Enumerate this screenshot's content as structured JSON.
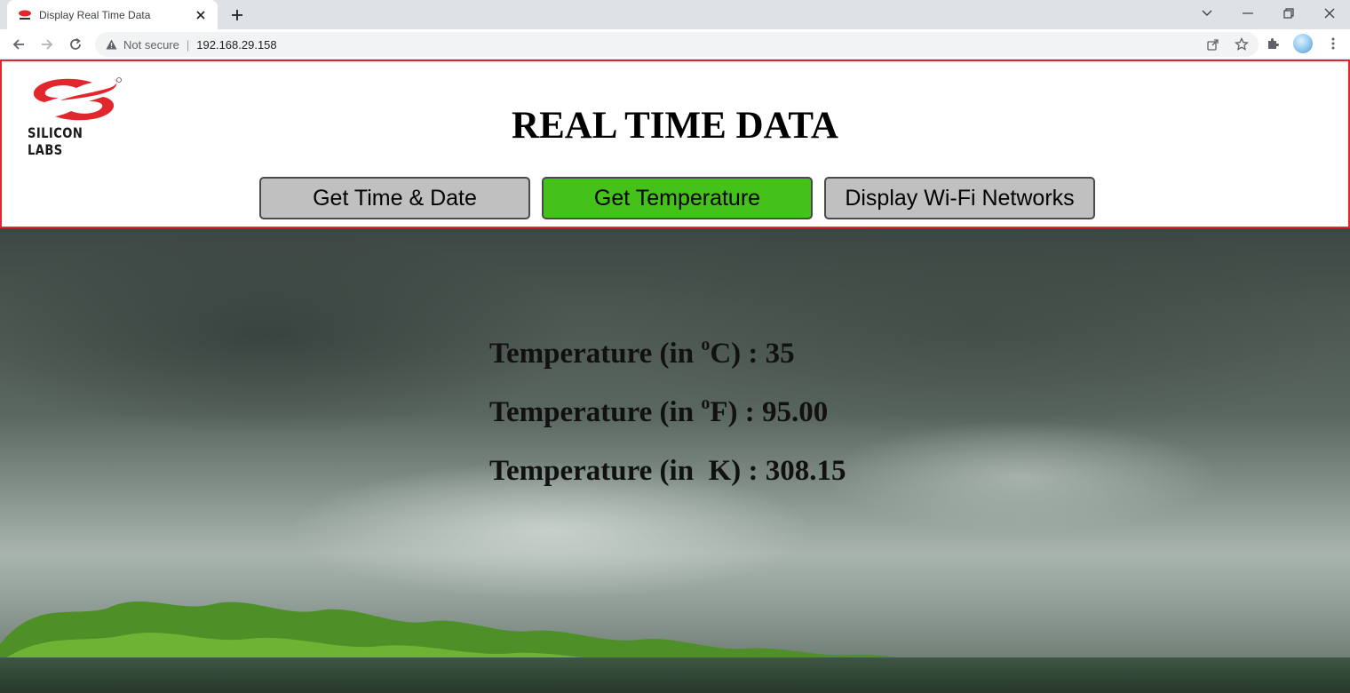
{
  "browser": {
    "tab_title": "Display Real Time Data",
    "address": {
      "security_label": "Not secure",
      "url": "192.168.29.158"
    }
  },
  "header": {
    "logo_text": "SILICON LABS",
    "title": "REAL TIME DATA",
    "buttons": [
      {
        "label": "Get Time & Date",
        "color": "#c0c0c0",
        "active": false
      },
      {
        "label": "Get Temperature",
        "color": "#45c21a",
        "active": true
      },
      {
        "label": "Display Wi-Fi Networks",
        "color": "#c0c0c0",
        "active": false
      }
    ]
  },
  "readings": [
    {
      "prefix": "Temperature (in ",
      "unit_sup": "o",
      "unit": "C",
      "separator": ") : ",
      "value": "35"
    },
    {
      "prefix": "Temperature (in ",
      "unit_sup": "o",
      "unit": "F",
      "separator": ") : ",
      "value": "95.00"
    },
    {
      "prefix": "Temperature (in  ",
      "unit_sup": "",
      "unit": "K",
      "separator": ") : ",
      "value": "308.15"
    }
  ],
  "colors": {
    "header_border": "#e1272d",
    "logo_red": "#e1272d",
    "active_button": "#45c21a",
    "inactive_button": "#c0c0c0"
  },
  "icons": {
    "back": "arrow-left-icon",
    "forward": "arrow-right-icon",
    "reload": "reload-icon",
    "warning": "warning-triangle-icon",
    "share": "share-icon",
    "bookmark": "star-icon",
    "extensions": "puzzle-icon",
    "menu": "kebab-menu-icon"
  }
}
